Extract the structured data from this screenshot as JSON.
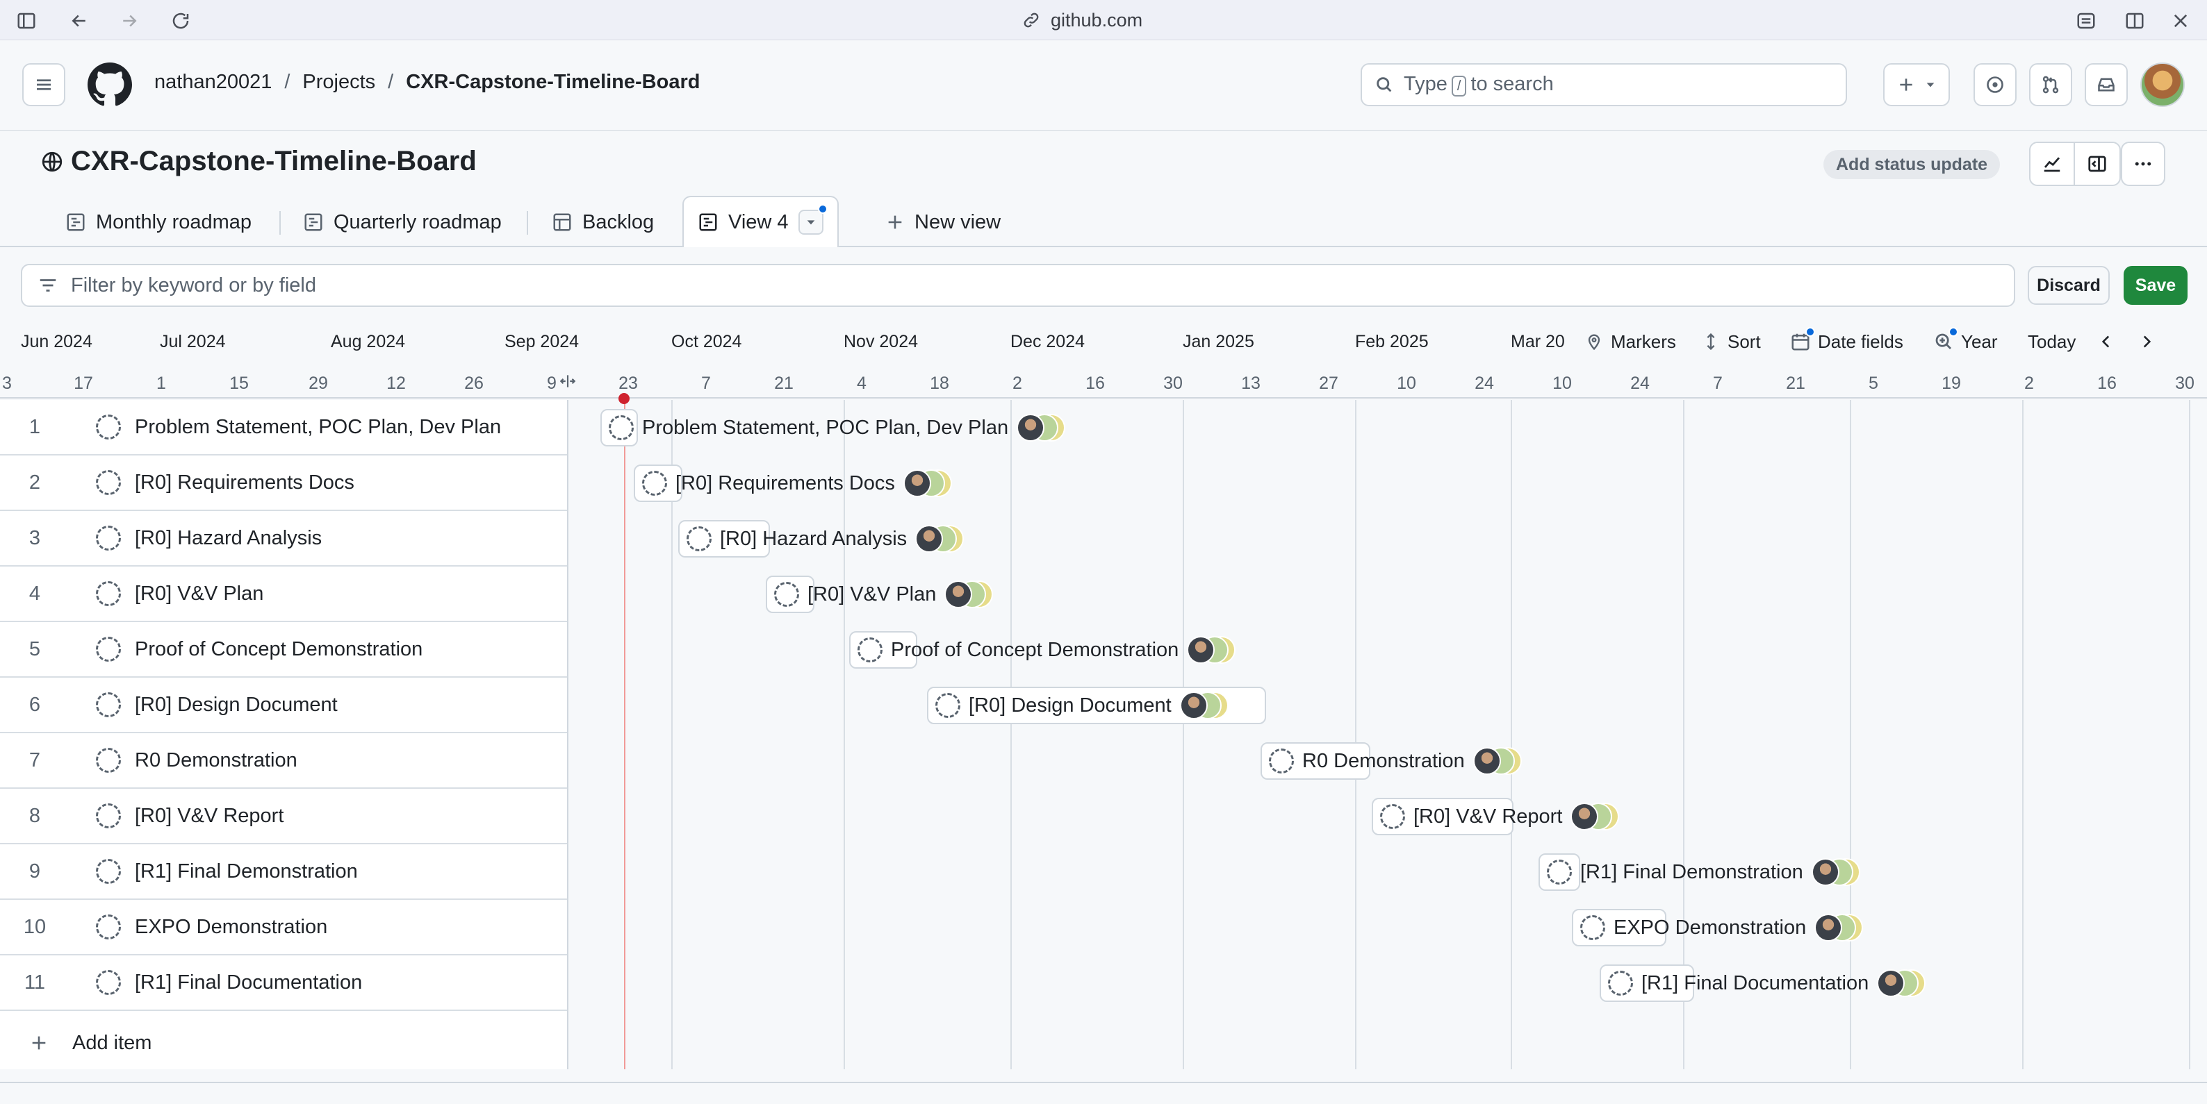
{
  "browser": {
    "url": "github.com"
  },
  "header": {
    "breadcrumb": {
      "owner": "nathan20021",
      "section": "Projects",
      "project": "CXR-Capstone-Timeline-Board"
    },
    "search": {
      "pre": "Type",
      "key": "/",
      "post": "to search"
    }
  },
  "project": {
    "title": "CXR-Capstone-Timeline-Board",
    "status_update": "Add status update"
  },
  "tabs": [
    {
      "label": "Monthly roadmap",
      "icon": "roadmap-icon"
    },
    {
      "label": "Quarterly roadmap",
      "icon": "roadmap-icon"
    },
    {
      "label": "Backlog",
      "icon": "table-icon"
    },
    {
      "label": "View 4",
      "icon": "roadmap-icon",
      "active": true
    },
    {
      "label": "New view",
      "icon": "plus-icon"
    }
  ],
  "filter": {
    "placeholder": "Filter by keyword or by field",
    "discard": "Discard",
    "save": "Save"
  },
  "timeline": {
    "months": [
      "Jun 2024",
      "Jul 2024",
      "Aug 2024",
      "Sep 2024",
      "Oct 2024",
      "Nov 2024",
      "Dec 2024",
      "Jan 2025",
      "Feb 2025",
      "Mar 20"
    ],
    "days": [
      "3",
      "17",
      "1",
      "15",
      "29",
      "12",
      "26",
      "9",
      "23",
      "7",
      "21",
      "4",
      "18",
      "2",
      "16",
      "30",
      "13",
      "27",
      "10",
      "24",
      "10",
      "24",
      "7",
      "21",
      "5",
      "19",
      "2",
      "16",
      "30"
    ],
    "toolbar": {
      "markers": "Markers",
      "sort": "Sort",
      "date_fields": "Date fields",
      "zoom": "Year",
      "today": "Today"
    }
  },
  "items": [
    {
      "num": "1",
      "title": "Problem Statement, POC Plan, Dev Plan"
    },
    {
      "num": "2",
      "title": "[R0] Requirements Docs"
    },
    {
      "num": "3",
      "title": "[R0] Hazard Analysis"
    },
    {
      "num": "4",
      "title": "[R0] V&V Plan"
    },
    {
      "num": "5",
      "title": "Proof of Concept Demonstration"
    },
    {
      "num": "6",
      "title": "[R0] Design Document"
    },
    {
      "num": "7",
      "title": "R0 Demonstration"
    },
    {
      "num": "8",
      "title": "[R0] V&V Report"
    },
    {
      "num": "9",
      "title": "[R1] Final Demonstration"
    },
    {
      "num": "10",
      "title": "EXPO Demonstration"
    },
    {
      "num": "11",
      "title": "[R1] Final Documentation"
    }
  ],
  "add_item": "Add item",
  "colors": {
    "save": "#1f883d",
    "today_marker": "#cf222e",
    "accent": "#0969da"
  }
}
